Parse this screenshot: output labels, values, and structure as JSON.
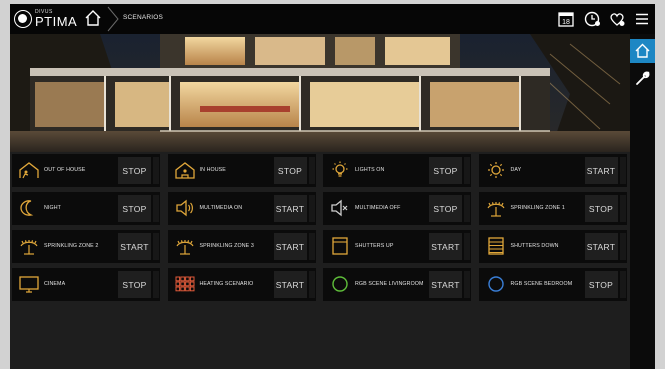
{
  "header": {
    "logo_small": "DIVUS",
    "logo_big": "PTIMA",
    "breadcrumb": "SCENARIOS"
  },
  "scenes": [
    {
      "label": "OUT OF HOUSE",
      "action": "STOP",
      "icon": "house-leave-icon",
      "color": "#e0a73a"
    },
    {
      "label": "IN HOUSE",
      "action": "STOP",
      "icon": "house-enter-icon",
      "color": "#e0a73a"
    },
    {
      "label": "LIGHTS ON",
      "action": "STOP",
      "icon": "light-bulb-icon",
      "color": "#e0a73a"
    },
    {
      "label": "DAY",
      "action": "START",
      "icon": "sun-icon",
      "color": "#e0a73a"
    },
    {
      "label": "NIGHT",
      "action": "STOP",
      "icon": "moon-icon",
      "color": "#e0a73a"
    },
    {
      "label": "MULTIMEDIA ON",
      "action": "START",
      "icon": "speaker-on-icon",
      "color": "#e0a73a"
    },
    {
      "label": "MULTIMEDIA OFF",
      "action": "STOP",
      "icon": "speaker-off-icon",
      "color": "#cfcfcf"
    },
    {
      "label": "SPRINKLING ZONE 1",
      "action": "STOP",
      "icon": "sprinkler-icon",
      "color": "#e0a73a"
    },
    {
      "label": "SPRINKLING ZONE 2",
      "action": "START",
      "icon": "sprinkler-icon",
      "color": "#e0a73a"
    },
    {
      "label": "SPRINKLING ZONE 3",
      "action": "START",
      "icon": "sprinkler-icon",
      "color": "#e0a73a"
    },
    {
      "label": "SHUTTERS UP",
      "action": "START",
      "icon": "shutter-up-icon",
      "color": "#e0a73a"
    },
    {
      "label": "SHUTTERS DOWN",
      "action": "START",
      "icon": "shutter-down-icon",
      "color": "#e0a73a"
    },
    {
      "label": "CINEMA",
      "action": "STOP",
      "icon": "tv-icon",
      "color": "#e0a73a"
    },
    {
      "label": "HEATING SCENARIO",
      "action": "START",
      "icon": "heating-grid-icon",
      "color": "#e05a3a"
    },
    {
      "label": "RGB SCENE LIVINGROOM",
      "action": "START",
      "icon": "rgb-circle-icon",
      "color": "#5fbf3a"
    },
    {
      "label": "RGB SCENE BEDROOM",
      "action": "STOP",
      "icon": "rgb-circle-icon",
      "color": "#3a7fd8"
    }
  ],
  "colors": {
    "accent": "#1d87c4",
    "icon": "#e0a73a"
  }
}
